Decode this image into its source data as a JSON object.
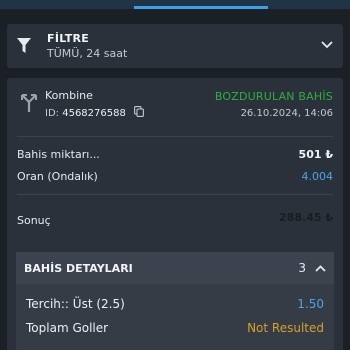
{
  "filter": {
    "title": "FİLTRE",
    "subtitle": "TÜMÜ, 24 saat"
  },
  "bet": {
    "type": "Kombine",
    "id_label": "ID:",
    "id_value": "4568276588",
    "status": "BOZDURULAN BAHİS",
    "date": "26.10.2024, 14:06",
    "stake_label": "Bahis miktarı...",
    "stake_value": "501 ₺",
    "odds_label": "Oran (Ondalık)",
    "odds_value": "4.004",
    "result_label": "Sonuç",
    "result_value": "288.45 ₺"
  },
  "details": {
    "title": "BAHİS DETAYLARI",
    "count": "3",
    "selection_label": "Tercih:: Üst (2.5)",
    "selection_odds": "1.50",
    "market_label": "Toplam Goller",
    "market_status": "Not Resulted"
  },
  "colors": {
    "accent_blue": "#3aa0e8",
    "status_green": "#2fae3f",
    "not_resulted": "#d8a028",
    "odds_blue": "#4aa3e8"
  },
  "icons": {
    "filter": "funnel-icon",
    "expand": "chevron-down-icon",
    "bet_type": "combo-arrows-icon",
    "copy": "copy-icon",
    "collapse": "chevron-up-icon"
  }
}
